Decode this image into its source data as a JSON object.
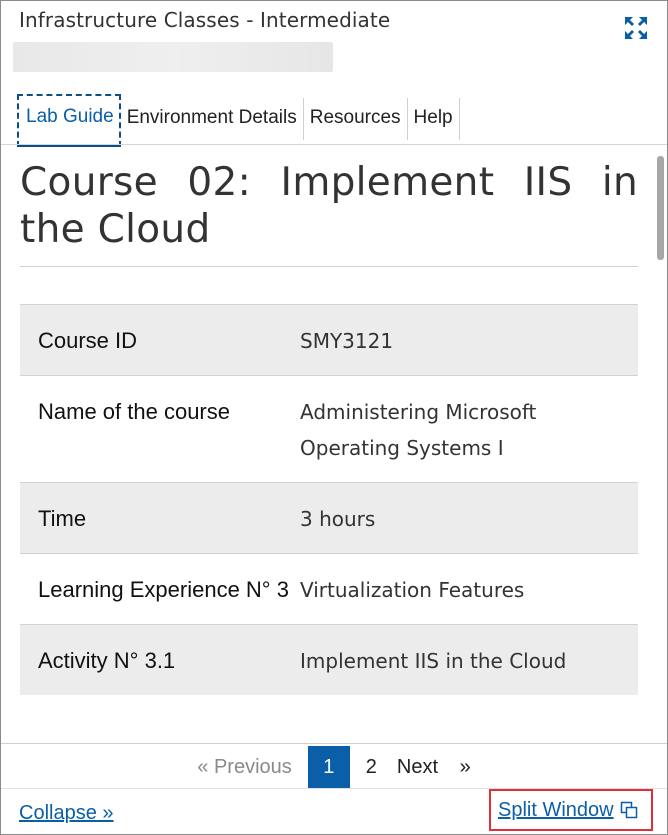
{
  "window": {
    "title": "Infrastructure Classes - Intermediate"
  },
  "tabs": [
    {
      "label": "Lab Guide",
      "active": true
    },
    {
      "label": "Environment Details",
      "active": false
    },
    {
      "label": "Resources",
      "active": false
    },
    {
      "label": "Help",
      "active": false
    }
  ],
  "content": {
    "heading": "Course 02: Implement IIS in the Cloud",
    "rows": [
      {
        "key": "Course ID",
        "value": "SMY3121"
      },
      {
        "key": "Name of the course",
        "value": "Administering Microsoft Operating Systems I"
      },
      {
        "key": "Time",
        "value": "3 hours"
      },
      {
        "key": "Learning Experience N° 3",
        "value": "Virtualization Features"
      },
      {
        "key": "Activity N° 3.1",
        "value": "Implement IIS in the Cloud"
      }
    ]
  },
  "pager": {
    "previous": "« Previous",
    "pages": [
      "1",
      "2"
    ],
    "current": "1",
    "next": "Next",
    "next_arrow": "»"
  },
  "footer": {
    "collapse": "Collapse »",
    "split": "Split Window"
  },
  "colors": {
    "accent": "#0b5ea8",
    "highlight_border": "#e0303a"
  },
  "icons": {
    "expand": "expand-arrows-icon",
    "split": "split-window-icon"
  }
}
